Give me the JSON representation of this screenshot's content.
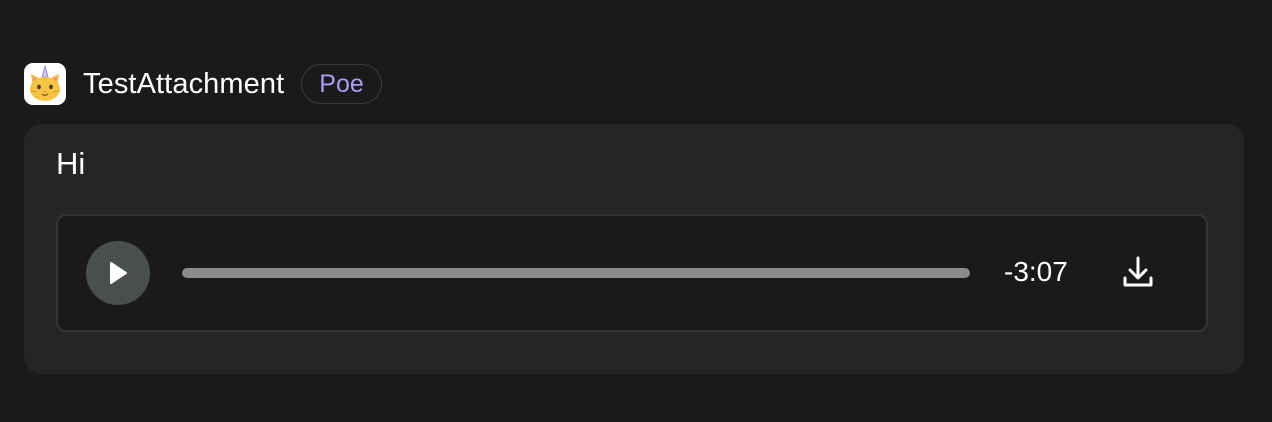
{
  "message": {
    "bot_name": "TestAttachment",
    "badge": "Poe",
    "text": "Hi"
  },
  "audio": {
    "time_remaining": "-3:07",
    "progress": 0
  },
  "colors": {
    "background": "#1a1a1a",
    "bubble": "#252525",
    "badge_text": "#a89cf5",
    "play_button": "#4a4f4e",
    "track": "#8a8a8a"
  },
  "icons": {
    "avatar": "cat-unicorn-avatar-icon",
    "play": "play-icon",
    "download": "download-icon"
  }
}
